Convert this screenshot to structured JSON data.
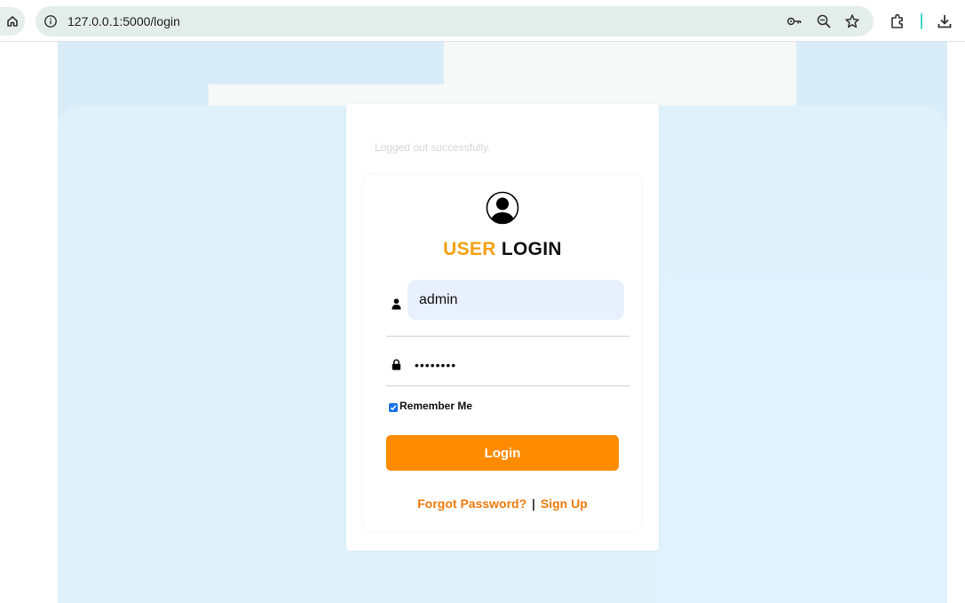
{
  "browser": {
    "url": "127.0.0.1:5000/login",
    "icons": [
      "home-icon",
      "site-info-icon",
      "password-key-icon",
      "zoom-icon",
      "bookmark-star-icon",
      "extensions-icon",
      "download-icon"
    ]
  },
  "flash_message": "Logged out successfully.",
  "login": {
    "title_highlight": "USER",
    "title_rest": "LOGIN",
    "username_value": "admin",
    "password_value": "••••••••",
    "remember_label": "Remember Me",
    "remember_checked": true,
    "submit_label": "Login",
    "forgot_label": "Forgot Password?",
    "separator": "|",
    "signup_label": "Sign Up"
  },
  "colors": {
    "accent": "#ff8c00",
    "title_highlight": "#f5a011",
    "link": "#f07b0d",
    "input_bg": "#e8f0fd"
  }
}
